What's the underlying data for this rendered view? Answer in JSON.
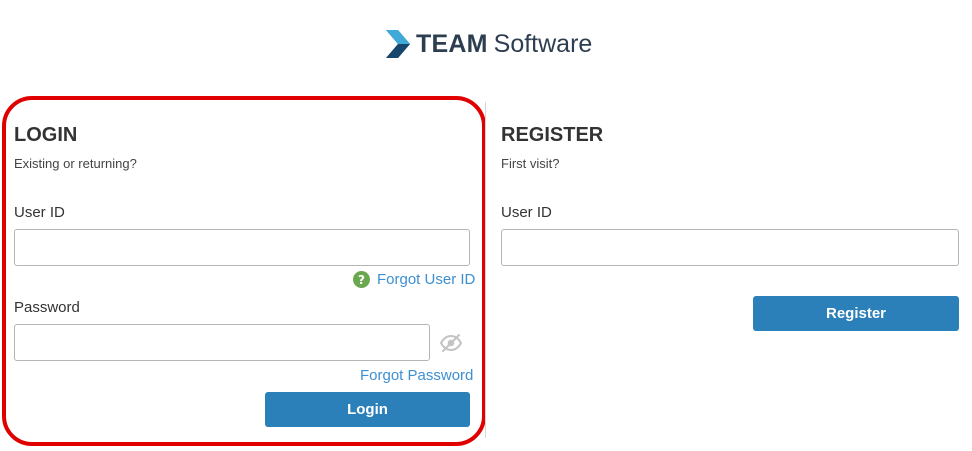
{
  "brand": {
    "name_bold": "TEAM",
    "name_light": "Software",
    "logo_icon": "team-chevron-logo-icon",
    "color": "#2c3e50"
  },
  "login": {
    "title": "LOGIN",
    "subtitle": "Existing or returning?",
    "user_id_label": "User ID",
    "user_id_value": "",
    "forgot_user_id": "Forgot User ID",
    "password_label": "Password",
    "password_value": "",
    "show_password_icon": "eye-slash-icon",
    "forgot_password": "Forgot Password",
    "login_button": "Login"
  },
  "register": {
    "title": "REGISTER",
    "subtitle": "First visit?",
    "user_id_label": "User ID",
    "user_id_value": "",
    "register_button": "Register"
  },
  "colors": {
    "button": "#2b80b9",
    "link": "#3d8fd1",
    "help_icon": "#6aa84f",
    "highlight": "#e00000"
  }
}
